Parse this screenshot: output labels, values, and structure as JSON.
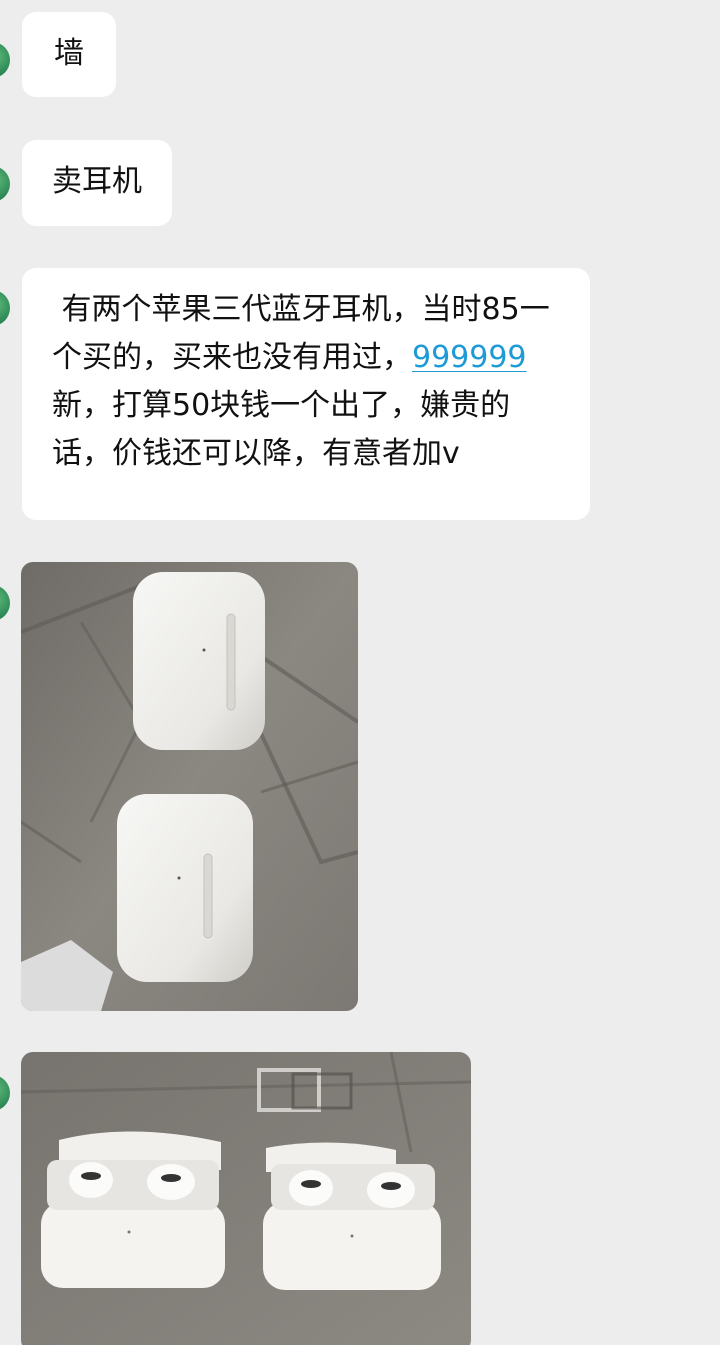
{
  "messages": [
    {
      "type": "text",
      "text": "墙"
    },
    {
      "type": "text",
      "text": "卖耳机"
    },
    {
      "type": "text",
      "text_before_link": " 有两个苹果三代蓝牙耳机，当时85一个买的，买来也没有用过，",
      "link_text": "999999",
      "text_after_link": "新，打算50块钱一个出了，嫌贵的话，价钱还可以降，有意者加v"
    },
    {
      "type": "image",
      "subject": "two white earbud charging cases on a tiled floor"
    },
    {
      "type": "image",
      "subject": "two open white earbud charging cases with earbuds inside"
    }
  ],
  "colors": {
    "background": "#ededed",
    "bubble": "#ffffff",
    "link": "#1e9bd7",
    "avatar_green": "#2e8b57"
  }
}
